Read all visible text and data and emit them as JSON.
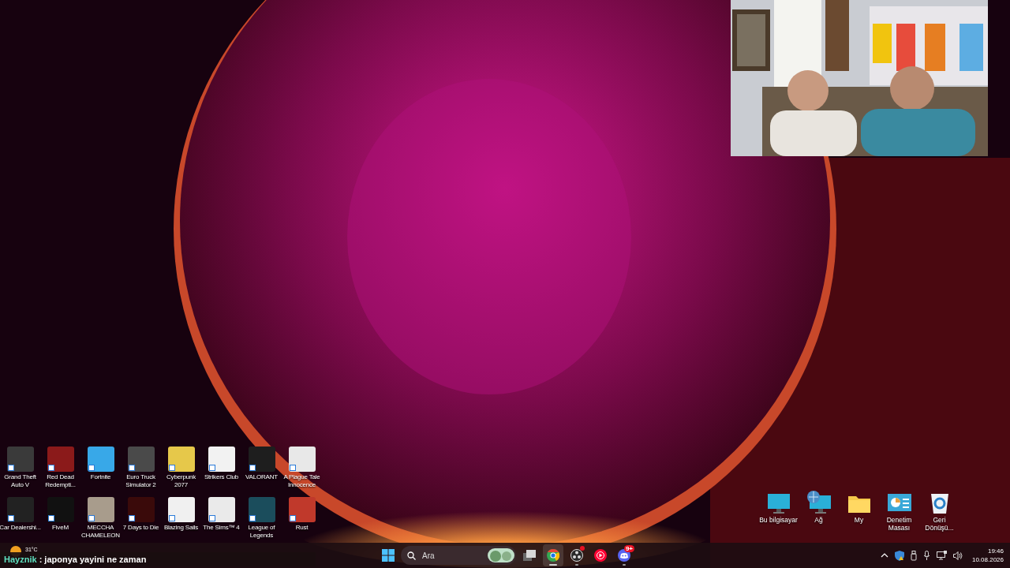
{
  "desktop_icons": [
    {
      "label": "Grand Theft Auto V"
    },
    {
      "label": "Red Dead Redempti..."
    },
    {
      "label": "Fortnite"
    },
    {
      "label": "Euro Truck Simulator 2"
    },
    {
      "label": "Cyberpunk 2077"
    },
    {
      "label": "Strikers Club"
    },
    {
      "label": "VALORANT"
    },
    {
      "label": "A Plague Tale Innocence"
    },
    {
      "label": "Car Dealershi..."
    },
    {
      "label": "FiveM"
    },
    {
      "label": "MECCHA CHAMELEON"
    },
    {
      "label": "7 Days to Die"
    },
    {
      "label": "Blazing Sails"
    },
    {
      "label": "The Sims™ 4"
    },
    {
      "label": "League of Legends"
    },
    {
      "label": "Rust"
    }
  ],
  "system_icons": [
    {
      "label": "Bu bilgisayar",
      "kind": "computer"
    },
    {
      "label": "Ağ",
      "kind": "network"
    },
    {
      "label": "My",
      "kind": "folder"
    },
    {
      "label": "Denetim Masası",
      "kind": "panel"
    },
    {
      "label": "Geri Dönüşü...",
      "kind": "bin"
    }
  ],
  "chat": {
    "user": "Hayznik",
    "message": ": japonya yayini ne zaman"
  },
  "taskbar": {
    "weather": {
      "temperature": "31°C"
    },
    "search": {
      "placeholder": "Ara"
    },
    "apps": [
      {
        "kind": "taskview",
        "selected": false,
        "running": false,
        "notification": false
      },
      {
        "kind": "chrome",
        "selected": true,
        "running": true,
        "notification": false
      },
      {
        "kind": "obs",
        "selected": false,
        "running": true,
        "notification": true
      },
      {
        "kind": "music",
        "selected": false,
        "running": false,
        "notification": false
      },
      {
        "kind": "discord",
        "selected": false,
        "running": true,
        "notification": false,
        "badge": "9+"
      }
    ],
    "clock": {
      "time": "19:46",
      "date": "10.08.2026"
    }
  }
}
